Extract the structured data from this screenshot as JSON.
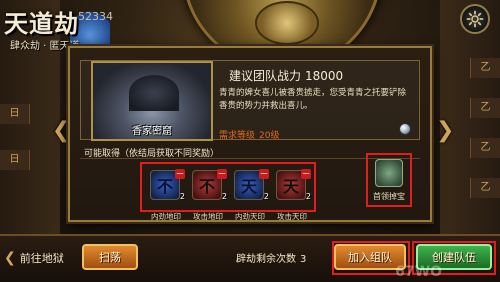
{
  "logo": {
    "title": "天道劫",
    "subtitle": "肆众劫 · 匿天道"
  },
  "background": {
    "score_text": "52334"
  },
  "side_tags": {
    "right": [
      "乙",
      "乙",
      "乙",
      "乙"
    ],
    "left": [
      "日",
      "日"
    ]
  },
  "dungeon": {
    "scene_label": "香家密窟",
    "power_label": "建议团队战力",
    "power_value": "18000",
    "description": "青青的婢女喜儿被香贵掳走，您受青青之托要铲除香贵的势力并救出喜儿。",
    "req_label": "需求等级",
    "req_value": "20级"
  },
  "rewards": {
    "title": "可能取得（依结局获取不同奖励）",
    "items": [
      {
        "label": "内劲地印",
        "tag": "一",
        "count": "2",
        "glyph": "不",
        "color": "blue"
      },
      {
        "label": "攻击地印",
        "tag": "一",
        "count": "2",
        "glyph": "不",
        "color": "red"
      },
      {
        "label": "内劲天印",
        "tag": "一",
        "count": "2",
        "glyph": "天",
        "color": "blue"
      },
      {
        "label": "攻击天印",
        "tag": "一",
        "count": "2",
        "glyph": "天",
        "color": "red"
      }
    ],
    "boss_label": "首领掉宝"
  },
  "bottom": {
    "back_label": "前往地狱",
    "sweep_label": "扫荡",
    "remaining_label": "辟劫剩余次数",
    "remaining_value": "3",
    "join_label": "加入组队",
    "create_label": "创建队伍"
  },
  "watermark": "67WO",
  "colors": {
    "accent_gold": "#9a7b3e",
    "highlight_red": "#e21d1d",
    "orange_button": "#e08a2e",
    "green_button": "#3fb24d",
    "req_text": "#e06a20"
  }
}
